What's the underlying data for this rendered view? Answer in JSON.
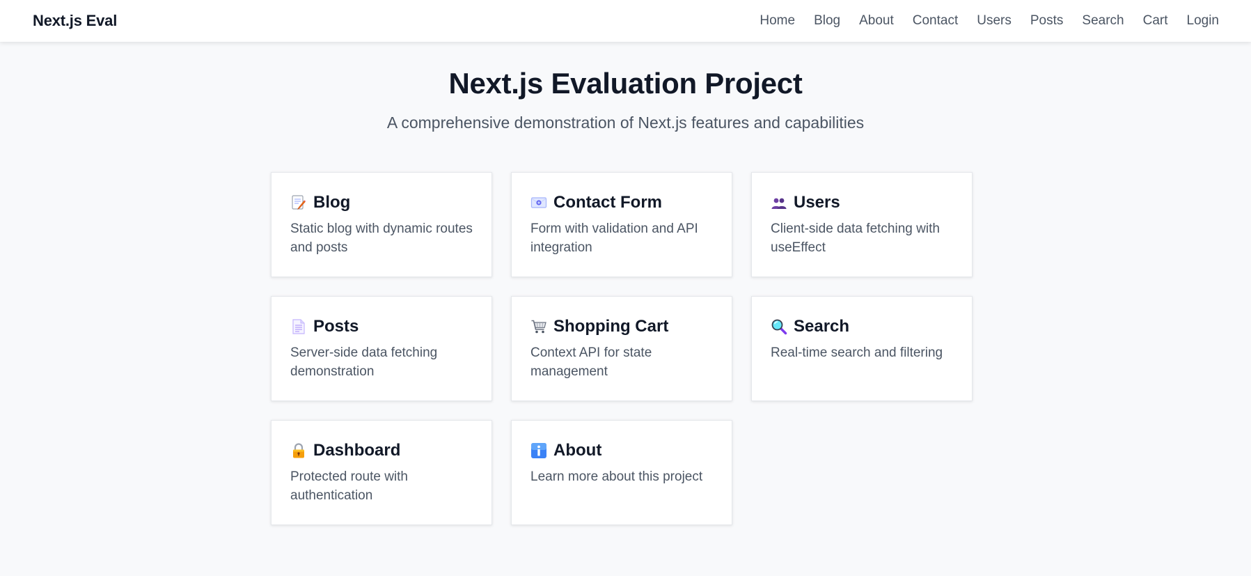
{
  "header": {
    "brand": "Next.js Eval",
    "nav": [
      "Home",
      "Blog",
      "About",
      "Contact",
      "Users",
      "Posts",
      "Search",
      "Cart",
      "Login"
    ]
  },
  "hero": {
    "title": "Next.js Evaluation Project",
    "subtitle": "A comprehensive demonstration of Next.js features and capabilities"
  },
  "cards": [
    {
      "icon": "memo-icon",
      "title": "Blog",
      "description": "Static blog with dynamic routes and posts"
    },
    {
      "icon": "envelope-icon",
      "title": "Contact Form",
      "description": "Form with validation and API integration"
    },
    {
      "icon": "users-icon",
      "title": "Users",
      "description": "Client-side data fetching with useEffect"
    },
    {
      "icon": "document-icon",
      "title": "Posts",
      "description": "Server-side data fetching demonstration"
    },
    {
      "icon": "shopping-cart-icon",
      "title": "Shopping Cart",
      "description": "Context API for state management"
    },
    {
      "icon": "magnifier-icon",
      "title": "Search",
      "description": "Real-time search and filtering"
    },
    {
      "icon": "lock-icon",
      "title": "Dashboard",
      "description": "Protected route with authentication"
    },
    {
      "icon": "info-icon",
      "title": "About",
      "description": "Learn more about this project"
    }
  ]
}
